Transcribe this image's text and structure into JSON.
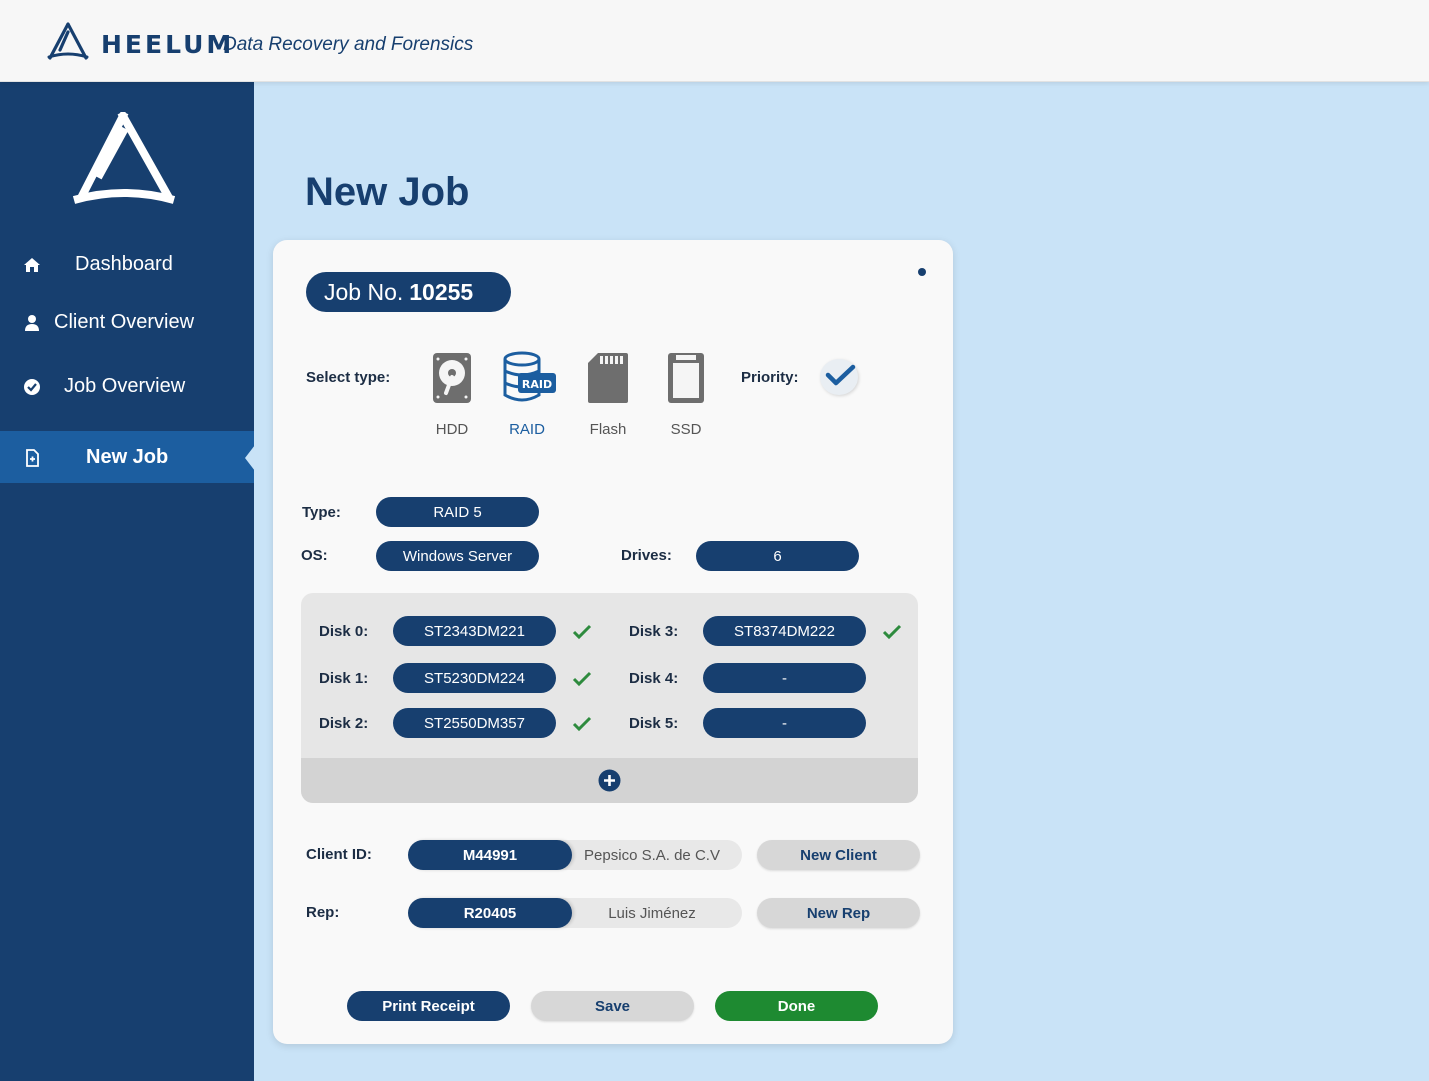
{
  "header": {
    "brand_name": "HEELUM",
    "brand_tagline": "Data Recovery and Forensics"
  },
  "sidebar": {
    "items": [
      {
        "label": "Dashboard",
        "icon": "home-icon"
      },
      {
        "label": "Client Overview",
        "icon": "user-icon"
      },
      {
        "label": "Job Overview",
        "icon": "check-circle-icon"
      },
      {
        "label": "New Job",
        "icon": "new-document-icon",
        "active": true
      }
    ]
  },
  "page": {
    "title": "New Job"
  },
  "job": {
    "number_prefix": "Job No.",
    "number": "10255"
  },
  "select_type": {
    "label": "Select type:",
    "options": [
      {
        "label": "HDD",
        "icon": "hdd-icon"
      },
      {
        "label": "RAID",
        "icon": "raid-icon",
        "selected": true
      },
      {
        "label": "Flash",
        "icon": "flash-card-icon"
      },
      {
        "label": "SSD",
        "icon": "ssd-icon"
      }
    ],
    "raid_badge": "RAID"
  },
  "priority": {
    "label": "Priority:",
    "checked": true
  },
  "fields": {
    "type_label": "Type:",
    "type_value": "RAID 5",
    "os_label": "OS:",
    "os_value": "Windows Server",
    "drives_label": "Drives:",
    "drives_value": "6"
  },
  "disks": [
    {
      "label": "Disk 0:",
      "value": "ST2343DM221",
      "verified": true
    },
    {
      "label": "Disk 1:",
      "value": "ST5230DM224",
      "verified": true
    },
    {
      "label": "Disk 2:",
      "value": "ST2550DM357",
      "verified": true
    },
    {
      "label": "Disk 3:",
      "value": "ST8374DM222",
      "verified": true
    },
    {
      "label": "Disk 4:",
      "value": "-",
      "verified": false
    },
    {
      "label": "Disk 5:",
      "value": "-",
      "verified": false
    }
  ],
  "client": {
    "label": "Client ID:",
    "id": "M44991",
    "name": "Pepsico S.A. de C.V",
    "new_button": "New Client"
  },
  "rep": {
    "label": "Rep:",
    "id": "R20405",
    "name": "Luis Jiménez",
    "new_button": "New Rep"
  },
  "actions": {
    "print": "Print Receipt",
    "save": "Save",
    "done": "Done"
  },
  "colors": {
    "primary": "#173f6f",
    "active_nav": "#1c5ea0",
    "background": "#c9e3f7",
    "success": "#1e8a31",
    "check_green": "#2e8b3e"
  }
}
